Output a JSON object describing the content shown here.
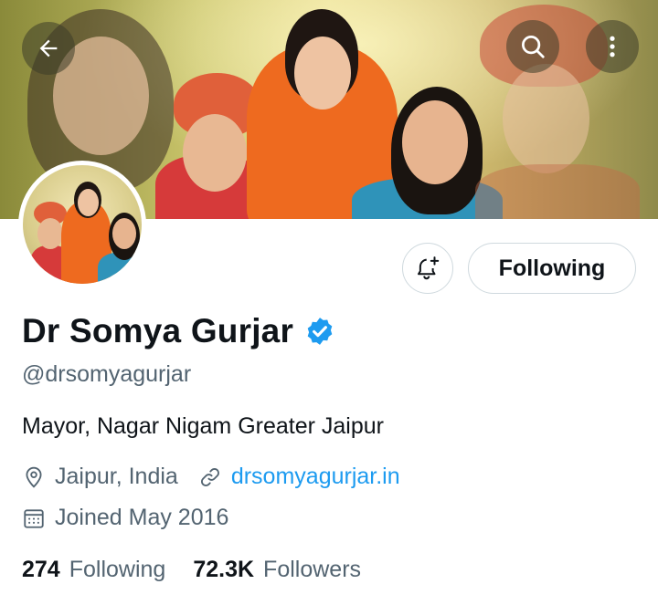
{
  "header": {
    "back_icon": "arrow-left-icon",
    "search_icon": "search-icon",
    "more_icon": "more-vertical-icon"
  },
  "profile": {
    "name": "Dr Somya Gurjar",
    "verified": true,
    "handle": "@drsomyagurjar",
    "bio": "Mayor, Nagar Nigam Greater Jaipur",
    "location": "Jaipur, India",
    "website": "drsomyagurjar.in",
    "joined": "Joined May 2016"
  },
  "actions": {
    "notify_icon": "bell-plus-icon",
    "follow_label": "Following"
  },
  "stats": {
    "following_count": "274",
    "following_label": "Following",
    "followers_count": "72.3K",
    "followers_label": "Followers"
  },
  "colors": {
    "accent": "#1d9bf0",
    "text_primary": "#0f1419",
    "text_secondary": "#536471",
    "border": "#cfd9de"
  }
}
